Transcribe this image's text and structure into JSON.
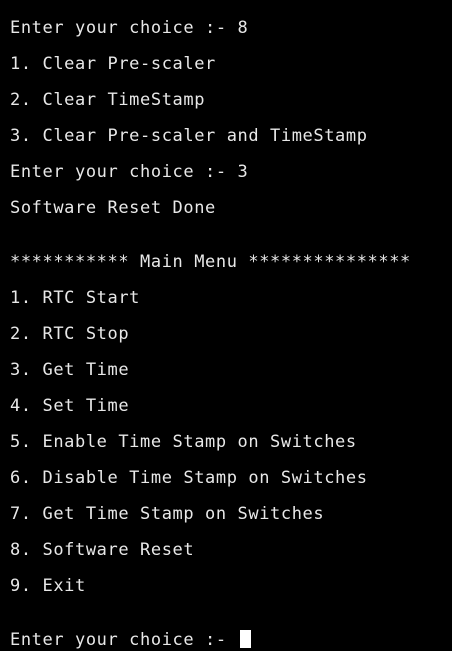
{
  "terminal": {
    "background": "#000000",
    "foreground": "#e8e8e8",
    "lines": [
      "Enter your choice :- 8",
      "1. Clear Pre-scaler",
      "2. Clear TimeStamp",
      "3. Clear Pre-scaler and TimeStamp",
      "Enter your choice :- 3",
      "Software Reset Done",
      "*********** Main Menu ***************",
      "1. RTC Start",
      "2. RTC Stop",
      "3. Get Time",
      "4. Set Time",
      "5. Enable Time Stamp on Switches",
      "6. Disable Time Stamp on Switches",
      "7. Get Time Stamp on Switches",
      "8. Software Reset",
      "9. Exit"
    ],
    "prompt": "Enter your choice :- "
  }
}
